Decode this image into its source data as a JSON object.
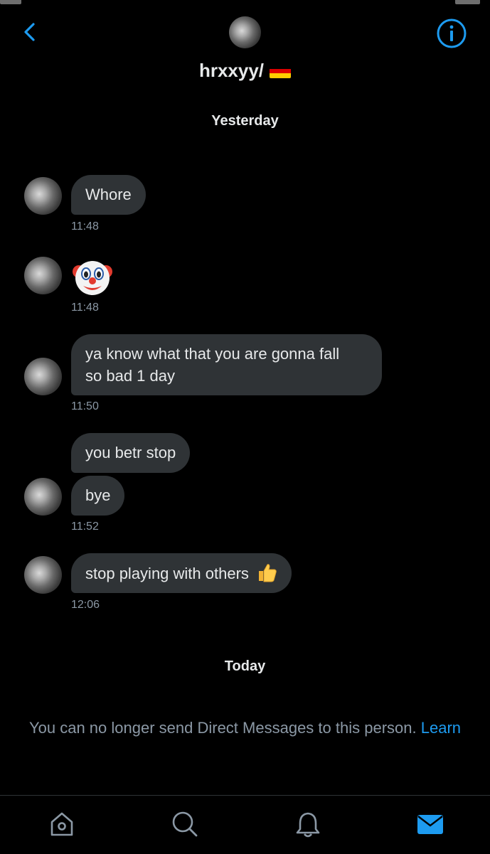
{
  "header": {
    "contact_name": "hrxxyy/",
    "flag_colors": [
      "#000000",
      "#dd0000",
      "#ffce00"
    ],
    "back_icon": "chevron-left-icon",
    "info_icon": "info-icon"
  },
  "colors": {
    "background": "#000000",
    "bubble": "#2f3336",
    "accent": "#1d9bf0",
    "muted": "#8b98a5"
  },
  "conversation": {
    "date_yesterday": "Yesterday",
    "messages": [
      {
        "text": "Whore",
        "time": "11:48"
      },
      {
        "emoji": "clown-face-icon",
        "time": "11:48"
      },
      {
        "lines": [
          "ya know what that you are gonna fall",
          "so bad 1 day"
        ],
        "time": "11:50"
      },
      {
        "text": "you betr stop"
      },
      {
        "text": "bye",
        "time": "11:52"
      },
      {
        "text": "stop playing with others",
        "emoji": "thumbs-up-icon",
        "time": "12:06"
      }
    ],
    "date_today": "Today"
  },
  "notice": {
    "text": "You can no longer send Direct Messages to this person.",
    "link": "Learn"
  },
  "tabbar": {
    "items": [
      "home-icon",
      "search-icon",
      "notifications-bell-icon",
      "messages-envelope-icon"
    ],
    "active": "messages-envelope-icon"
  }
}
